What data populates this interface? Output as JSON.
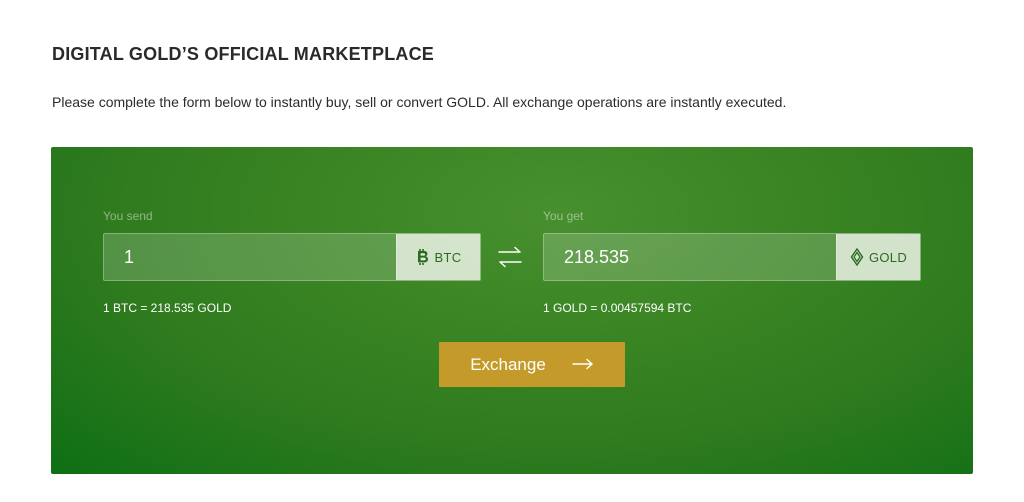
{
  "header": {
    "title": "DIGITAL GOLD’S OFFICIAL MARKETPLACE",
    "subtitle": "Please complete the form below to instantly buy, sell or convert GOLD. All exchange operations are instantly executed."
  },
  "exchange": {
    "send": {
      "label": "You send",
      "value": "1",
      "currency": "BTC",
      "currency_icon": "bitcoin-icon",
      "rate": "1 BTC = 218.535 GOLD"
    },
    "get": {
      "label": "You get",
      "value": "218.535",
      "currency": "GOLD",
      "currency_icon": "gold-diamond-icon",
      "rate": "1 GOLD = 0.00457594 BTC"
    },
    "swap_icon": "swap-arrows-icon",
    "button_label": "Exchange",
    "button_icon": "arrow-right-icon"
  },
  "colors": {
    "panel_green": "#3a8423",
    "button_gold": "#c49a2a",
    "currency_text": "#2b6a21"
  }
}
